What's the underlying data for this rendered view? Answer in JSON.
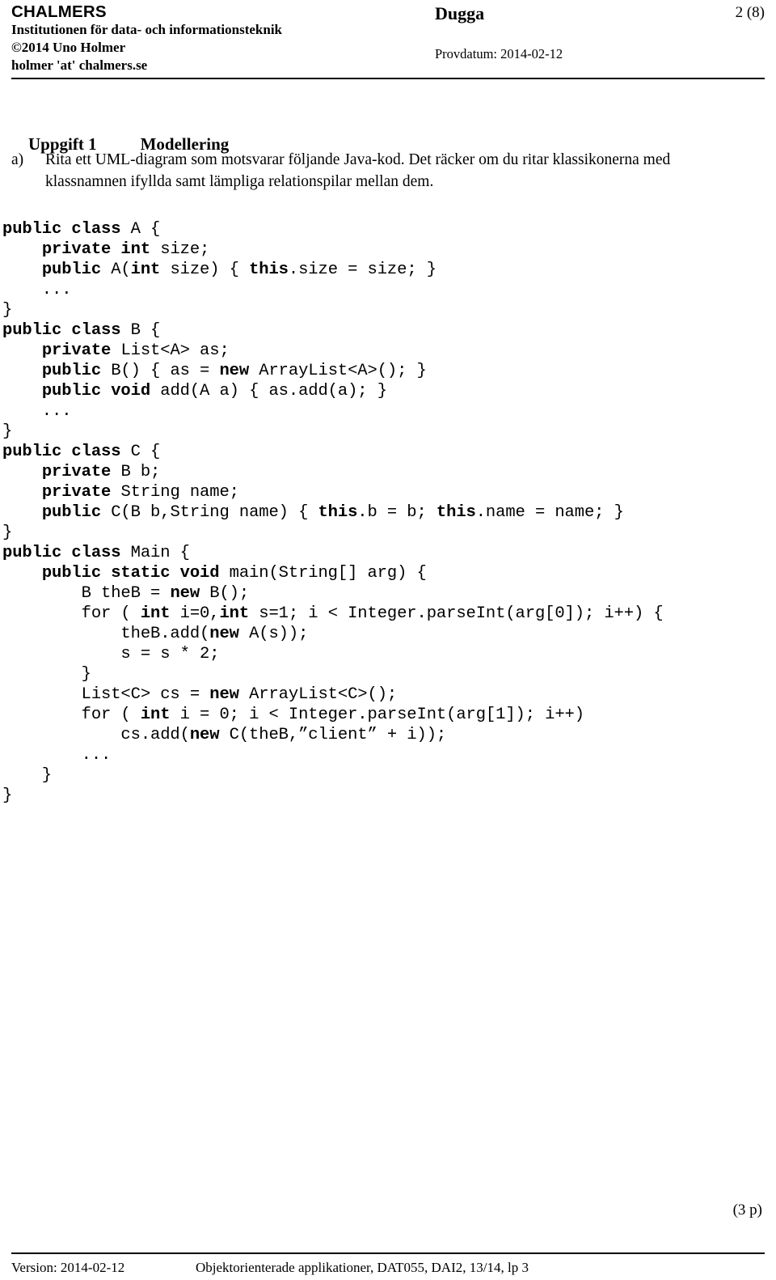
{
  "header": {
    "brand": "CHALMERS",
    "department": "Institutionen för data- och informationsteknik",
    "copyright": "©2014 Uno Holmer",
    "email": "holmer 'at' chalmers.se",
    "doc_type": "Dugga",
    "exam_date_label": "Provdatum: 2014-02-12",
    "page_indicator": "2 (8)"
  },
  "task": {
    "number_label": "Uppgift 1",
    "name": "Modellering"
  },
  "question": {
    "label": "a)",
    "text": "Rita ett UML-diagram som motsvarar följande Java-kod. Det räcker om du ritar klassikonerna med klassnamnen ifyllda samt lämpliga relationspilar mellan dem."
  },
  "code": {
    "language": "java",
    "lines": [
      [
        {
          "t": "public class ",
          "b": true
        },
        {
          "t": "A {",
          "b": false
        }
      ],
      [
        {
          "t": "    ",
          "b": false
        },
        {
          "t": "private int ",
          "b": true
        },
        {
          "t": "size;",
          "b": false
        }
      ],
      [
        {
          "t": "    ",
          "b": false
        },
        {
          "t": "public ",
          "b": true
        },
        {
          "t": "A(",
          "b": false
        },
        {
          "t": "int ",
          "b": true
        },
        {
          "t": "size) { ",
          "b": false
        },
        {
          "t": "this",
          "b": true
        },
        {
          "t": ".size = size; }",
          "b": false
        }
      ],
      [
        {
          "t": "    ...",
          "b": false
        }
      ],
      [
        {
          "t": "}",
          "b": false
        }
      ],
      [
        {
          "t": "public class ",
          "b": true
        },
        {
          "t": "B {",
          "b": false
        }
      ],
      [
        {
          "t": "    ",
          "b": false
        },
        {
          "t": "private ",
          "b": true
        },
        {
          "t": "List<A> as;",
          "b": false
        }
      ],
      [
        {
          "t": "    ",
          "b": false
        },
        {
          "t": "public ",
          "b": true
        },
        {
          "t": "B() { as = ",
          "b": false
        },
        {
          "t": "new ",
          "b": true
        },
        {
          "t": "ArrayList<A>(); }",
          "b": false
        }
      ],
      [
        {
          "t": "    ",
          "b": false
        },
        {
          "t": "public void ",
          "b": true
        },
        {
          "t": "add(A a) { as.add(a); }",
          "b": false
        }
      ],
      [
        {
          "t": "    ...",
          "b": false
        }
      ],
      [
        {
          "t": "}",
          "b": false
        }
      ],
      [
        {
          "t": "public class ",
          "b": true
        },
        {
          "t": "C {",
          "b": false
        }
      ],
      [
        {
          "t": "    ",
          "b": false
        },
        {
          "t": "private ",
          "b": true
        },
        {
          "t": "B b;",
          "b": false
        }
      ],
      [
        {
          "t": "    ",
          "b": false
        },
        {
          "t": "private ",
          "b": true
        },
        {
          "t": "String name;",
          "b": false
        }
      ],
      [
        {
          "t": "    ",
          "b": false
        },
        {
          "t": "public ",
          "b": true
        },
        {
          "t": "C(B b,String name) { ",
          "b": false
        },
        {
          "t": "this",
          "b": true
        },
        {
          "t": ".b = b; ",
          "b": false
        },
        {
          "t": "this",
          "b": true
        },
        {
          "t": ".name = name; }",
          "b": false
        }
      ],
      [
        {
          "t": "}",
          "b": false
        }
      ],
      [
        {
          "t": "public class ",
          "b": true
        },
        {
          "t": "Main {",
          "b": false
        }
      ],
      [
        {
          "t": "    ",
          "b": false
        },
        {
          "t": "public static void ",
          "b": true
        },
        {
          "t": "main(String[] arg) {",
          "b": false
        }
      ],
      [
        {
          "t": "        B theB = ",
          "b": false
        },
        {
          "t": "new ",
          "b": true
        },
        {
          "t": "B();",
          "b": false
        }
      ],
      [
        {
          "t": "        for ( ",
          "b": false
        },
        {
          "t": "int ",
          "b": true
        },
        {
          "t": "i=0,",
          "b": false
        },
        {
          "t": "int ",
          "b": true
        },
        {
          "t": "s=1; i < Integer.parseInt(arg[0]); i++) {",
          "b": false
        }
      ],
      [
        {
          "t": "            theB.add(",
          "b": false
        },
        {
          "t": "new ",
          "b": true
        },
        {
          "t": "A(s));",
          "b": false
        }
      ],
      [
        {
          "t": "            s = s * 2;",
          "b": false
        }
      ],
      [
        {
          "t": "        }",
          "b": false
        }
      ],
      [
        {
          "t": "        List<C> cs = ",
          "b": false
        },
        {
          "t": "new ",
          "b": true
        },
        {
          "t": "ArrayList<C>();",
          "b": false
        }
      ],
      [
        {
          "t": "        for ( ",
          "b": false
        },
        {
          "t": "int ",
          "b": true
        },
        {
          "t": "i = 0; i < Integer.parseInt(arg[1]); i++)",
          "b": false
        }
      ],
      [
        {
          "t": "            cs.add(",
          "b": false
        },
        {
          "t": "new ",
          "b": true
        },
        {
          "t": "C(theB,”client” + i));",
          "b": false
        }
      ],
      [
        {
          "t": "        ...",
          "b": false
        }
      ],
      [
        {
          "t": "    }",
          "b": false
        }
      ],
      [
        {
          "t": "}",
          "b": false
        }
      ]
    ]
  },
  "points": "(3 p)",
  "footer": {
    "version": "Version: 2014-02-12",
    "course": "Objektorienterade applikationer, DAT055, DAI2, 13/14, lp 3"
  }
}
